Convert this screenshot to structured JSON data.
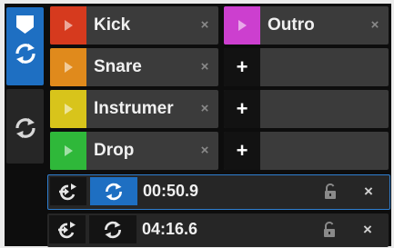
{
  "mode_buttons": [
    {
      "name": "hotcue-mode",
      "active": true,
      "icons": [
        "cue-marker-icon",
        "loop-icon"
      ],
      "color": "#1e6fc2"
    },
    {
      "name": "loop-mode",
      "active": false,
      "icons": [
        "loop-icon"
      ]
    }
  ],
  "hotcues": [
    {
      "label": "Kick",
      "color": "#d63a1e"
    },
    {
      "label": "Outro",
      "color": "#cc3fcf"
    },
    {
      "label": "Snare",
      "color": "#e08a1c"
    },
    {
      "label": "",
      "empty": true,
      "add_label": "+"
    },
    {
      "label": "Instrumer",
      "color": "#d8c41b"
    },
    {
      "label": "",
      "empty": true,
      "add_label": "+"
    },
    {
      "label": "Drop",
      "color": "#2fb83a"
    },
    {
      "label": "",
      "empty": true,
      "add_label": "+"
    }
  ],
  "close_label": "×",
  "loops": [
    {
      "time": "00:50.9",
      "selected": true,
      "active": true,
      "close_label": "×"
    },
    {
      "time": "04:16.6",
      "selected": false,
      "active": false,
      "close_label": "×"
    }
  ]
}
